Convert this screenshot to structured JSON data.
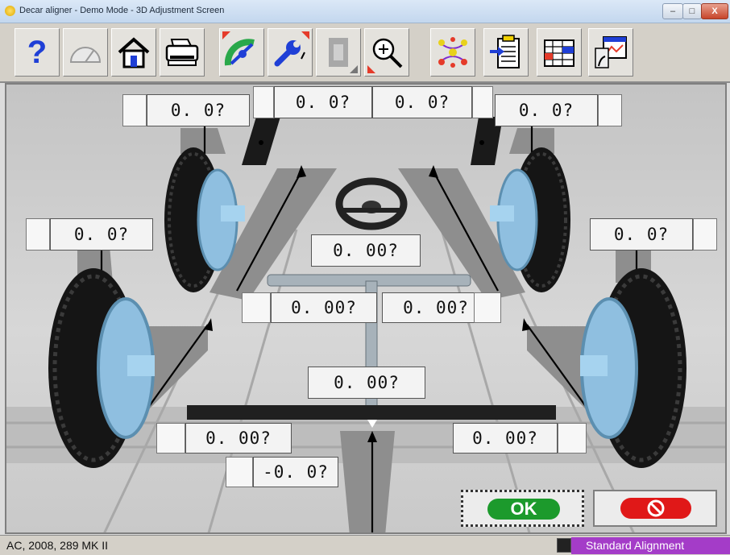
{
  "window": {
    "title": "Decar aligner - Demo Mode  -  3D Adjustment Screen",
    "controls": [
      "minimize",
      "maximize",
      "close"
    ],
    "close_glyph": "X"
  },
  "toolbar": {
    "items": [
      {
        "name": "help-icon",
        "glyph": "?"
      },
      {
        "name": "gauge-icon"
      },
      {
        "name": "home-icon"
      },
      {
        "name": "printer-icon"
      },
      {
        "name": "adjust-measure-icon"
      },
      {
        "name": "wrench-tool-icon"
      },
      {
        "name": "film-strip-icon"
      },
      {
        "name": "zoom-in-icon"
      },
      {
        "name": "dots-pattern-icon"
      },
      {
        "name": "clipboard-import-icon"
      },
      {
        "name": "spreadsheet-icon"
      },
      {
        "name": "report-window-icon"
      }
    ]
  },
  "readings": {
    "front_left_outer": "0. 0?",
    "front_left_inner": "0. 0?",
    "front_right_inner": "0. 0?",
    "front_right_outer": "0. 0?",
    "rear_left_outer": "0. 0?",
    "rear_right_outer": "0. 0?",
    "steering": "0. 00?",
    "front_left_toe": "0. 00?",
    "front_right_toe": "0. 00?",
    "rear_total_toe": "0. 00?",
    "rear_left_toe": "0. 00?",
    "rear_right_toe": "0. 00?",
    "thrust_angle": "-0. 0?"
  },
  "buttons": {
    "ok_label": "OK"
  },
  "status": {
    "vehicle": "AC, 2008, 289 MK II",
    "mode": "Standard Alignment"
  },
  "colors": {
    "ok_green": "#1c9a2c",
    "cancel_red": "#e01818",
    "mode_purple": "#a43cc8"
  }
}
